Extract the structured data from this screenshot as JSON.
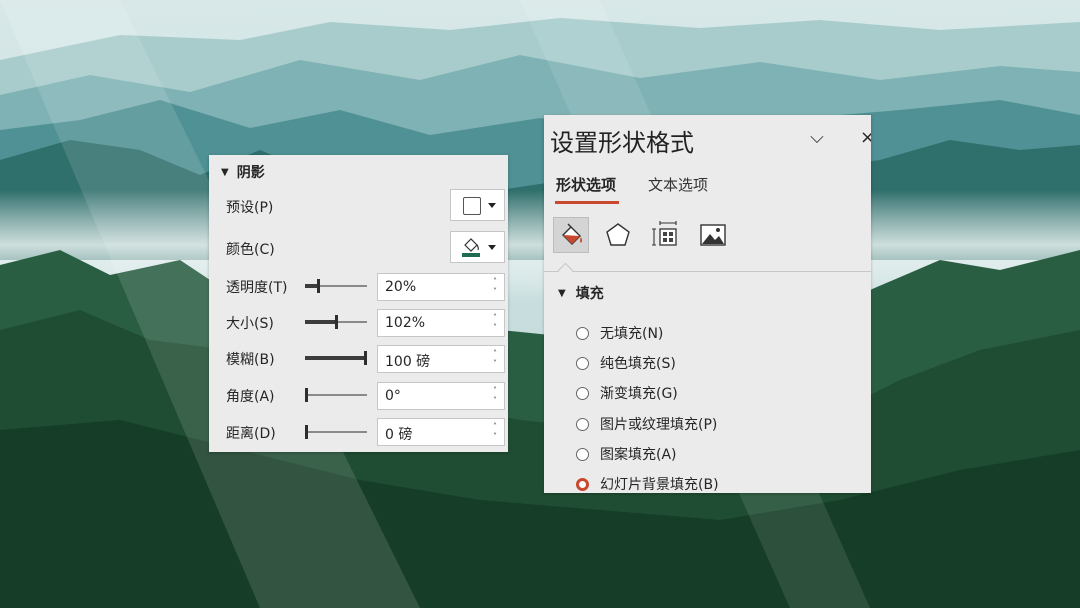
{
  "shadow": {
    "section_title": "阴影",
    "rows": {
      "preset": "预设(P)",
      "color": "颜色(C)",
      "transparency": {
        "label": "透明度(T)",
        "value": "20%",
        "level": 0.2
      },
      "size": {
        "label": "大小(S)",
        "value": "102%",
        "level": 0.5
      },
      "blur": {
        "label": "模糊(B)",
        "value": "100 磅",
        "level": 1.0
      },
      "angle": {
        "label": "角度(A)",
        "value": "0°",
        "level": 0.0
      },
      "distance": {
        "label": "距离(D)",
        "value": "0 磅",
        "level": 0.0
      }
    },
    "shadow_color": "#1f6b54"
  },
  "format_panel": {
    "title": "设置形状格式",
    "tabs": {
      "shape_options": "形状选项",
      "text_options": "文本选项"
    },
    "icons": [
      "fill-line-icon",
      "effects-pentagon-icon",
      "size-properties-icon",
      "picture-icon"
    ],
    "fill_section": "填充",
    "fill_options": [
      {
        "label": "无填充(N)",
        "checked": false
      },
      {
        "label": "纯色填充(S)",
        "checked": false
      },
      {
        "label": "渐变填充(G)",
        "checked": false
      },
      {
        "label": "图片或纹理填充(P)",
        "checked": false
      },
      {
        "label": "图案填充(A)",
        "checked": false
      },
      {
        "label": "幻灯片背景填充(B)",
        "checked": true
      }
    ],
    "accent_color": "#c8492e"
  }
}
